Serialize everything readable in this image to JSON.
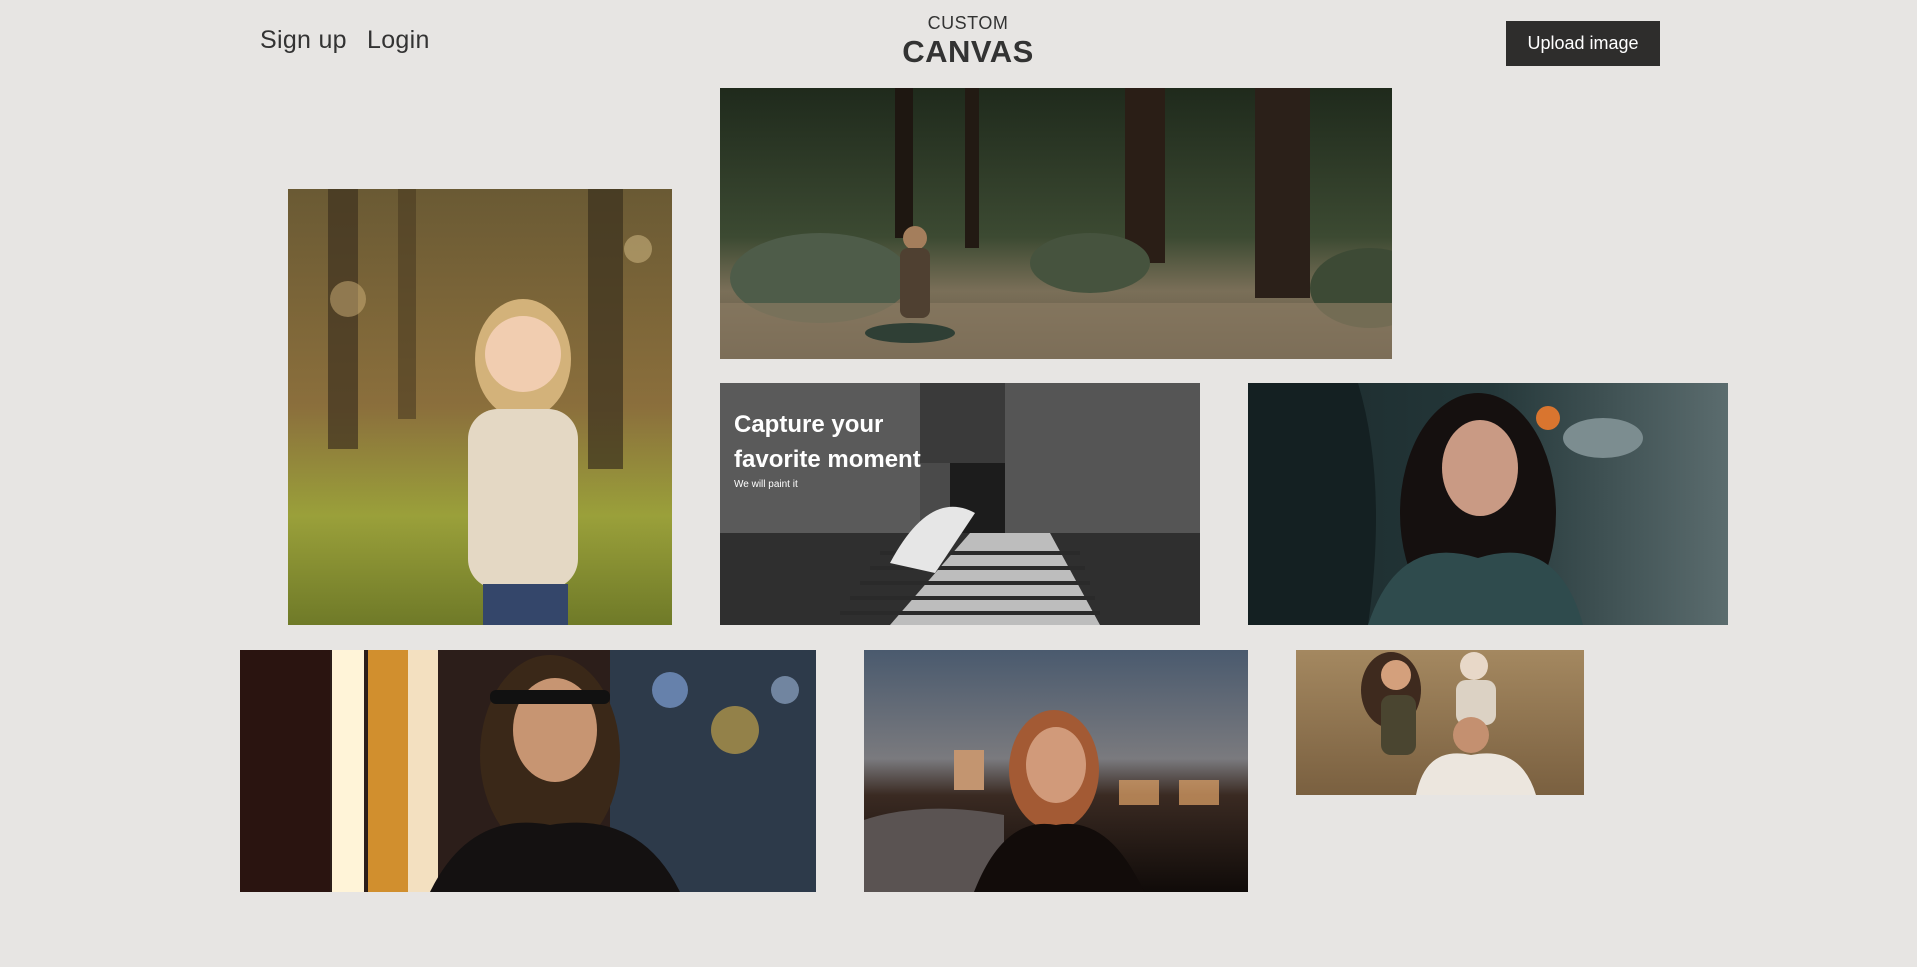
{
  "header": {
    "signup_label": "Sign up",
    "login_label": "Login",
    "brand_top": "CUSTOM",
    "brand_main": "CANVAS",
    "upload_label": "Upload image"
  },
  "gallery": {
    "promo": {
      "headline": "Capture your favorite moment",
      "subline": "We will paint it"
    }
  },
  "colors": {
    "background": "#e7e5e3",
    "button_bg": "#2e2d2c",
    "text": "#333333"
  }
}
